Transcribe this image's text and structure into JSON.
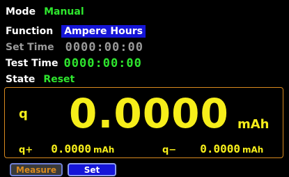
{
  "params": {
    "mode": {
      "label": "Mode",
      "value": "Manual"
    },
    "function": {
      "label": "Function",
      "value": "Ampere Hours"
    },
    "set_time": {
      "label": "Set Time",
      "value": "0000:00:00"
    },
    "test_time": {
      "label": "Test Time",
      "value": "0000:00:00"
    },
    "state": {
      "label": "State",
      "value": "Reset"
    }
  },
  "meter": {
    "label": "q",
    "value": "0.0000",
    "unit": "mAh",
    "q_plus": {
      "label": "q+",
      "value": "0.0000",
      "unit": "mAh"
    },
    "q_minus": {
      "label": "q−",
      "value": "0.0000",
      "unit": "mAh"
    }
  },
  "softkeys": {
    "measure": "Measure",
    "set": "Set"
  },
  "colors": {
    "background": "#000000",
    "value_green": "#2ee62e",
    "meter_yellow": "#f6ee1a",
    "frame_orange": "#d98a1f",
    "highlight_blue": "#1515d8",
    "dim_gray": "#9a9a9a"
  }
}
